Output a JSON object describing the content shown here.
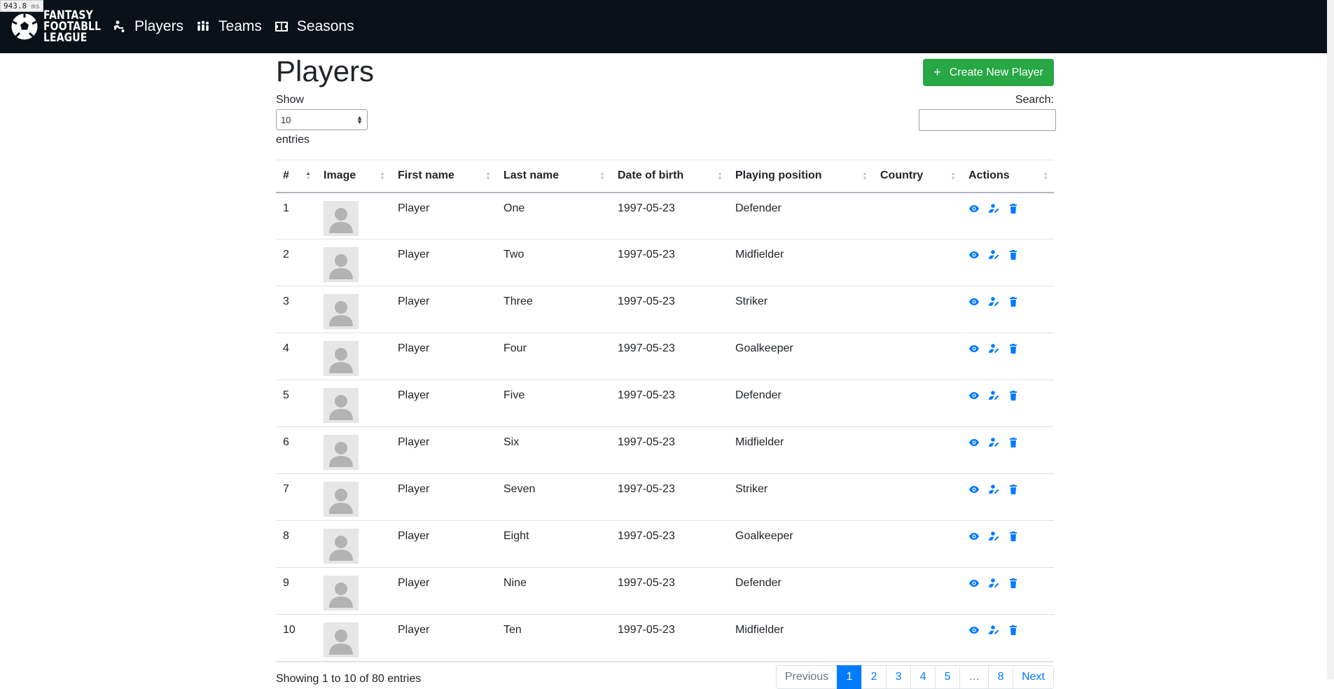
{
  "perf": {
    "value": "943.8",
    "unit": "ms"
  },
  "nav": {
    "brand": {
      "line1": "FANTASY",
      "line2": "FOOTABLL",
      "line3": "LEAGUE"
    },
    "links": [
      {
        "label": "Players",
        "icon": "player-icon"
      },
      {
        "label": "Teams",
        "icon": "team-icon"
      },
      {
        "label": "Seasons",
        "icon": "season-icon"
      }
    ]
  },
  "page": {
    "title": "Players",
    "create_button": "Create New Player",
    "create_icon": "+"
  },
  "controls": {
    "show_label": "Show",
    "length_value": "10",
    "entries_label": "entries",
    "search_label": "Search:",
    "search_value": ""
  },
  "table": {
    "columns": [
      "#",
      "Image",
      "First name",
      "Last name",
      "Date of birth",
      "Playing position",
      "Country",
      "Actions"
    ],
    "rows": [
      {
        "num": "1",
        "first": "Player",
        "last": "One",
        "dob": "1997-05-23",
        "position": "Defender",
        "country": ""
      },
      {
        "num": "2",
        "first": "Player",
        "last": "Two",
        "dob": "1997-05-23",
        "position": "Midfielder",
        "country": ""
      },
      {
        "num": "3",
        "first": "Player",
        "last": "Three",
        "dob": "1997-05-23",
        "position": "Striker",
        "country": ""
      },
      {
        "num": "4",
        "first": "Player",
        "last": "Four",
        "dob": "1997-05-23",
        "position": "Goalkeeper",
        "country": ""
      },
      {
        "num": "5",
        "first": "Player",
        "last": "Five",
        "dob": "1997-05-23",
        "position": "Defender",
        "country": ""
      },
      {
        "num": "6",
        "first": "Player",
        "last": "Six",
        "dob": "1997-05-23",
        "position": "Midfielder",
        "country": ""
      },
      {
        "num": "7",
        "first": "Player",
        "last": "Seven",
        "dob": "1997-05-23",
        "position": "Striker",
        "country": ""
      },
      {
        "num": "8",
        "first": "Player",
        "last": "Eight",
        "dob": "1997-05-23",
        "position": "Goalkeeper",
        "country": ""
      },
      {
        "num": "9",
        "first": "Player",
        "last": "Nine",
        "dob": "1997-05-23",
        "position": "Defender",
        "country": ""
      },
      {
        "num": "10",
        "first": "Player",
        "last": "Ten",
        "dob": "1997-05-23",
        "position": "Midfielder",
        "country": ""
      }
    ]
  },
  "footer": {
    "info": "Showing 1 to 10 of 80 entries",
    "pagination": {
      "previous": "Previous",
      "pages": [
        "1",
        "2",
        "3",
        "4",
        "5",
        "…",
        "8"
      ],
      "active": "1",
      "next": "Next"
    }
  },
  "colors": {
    "navbar": "#0b1118",
    "primary": "#007bff",
    "success": "#28a745"
  }
}
